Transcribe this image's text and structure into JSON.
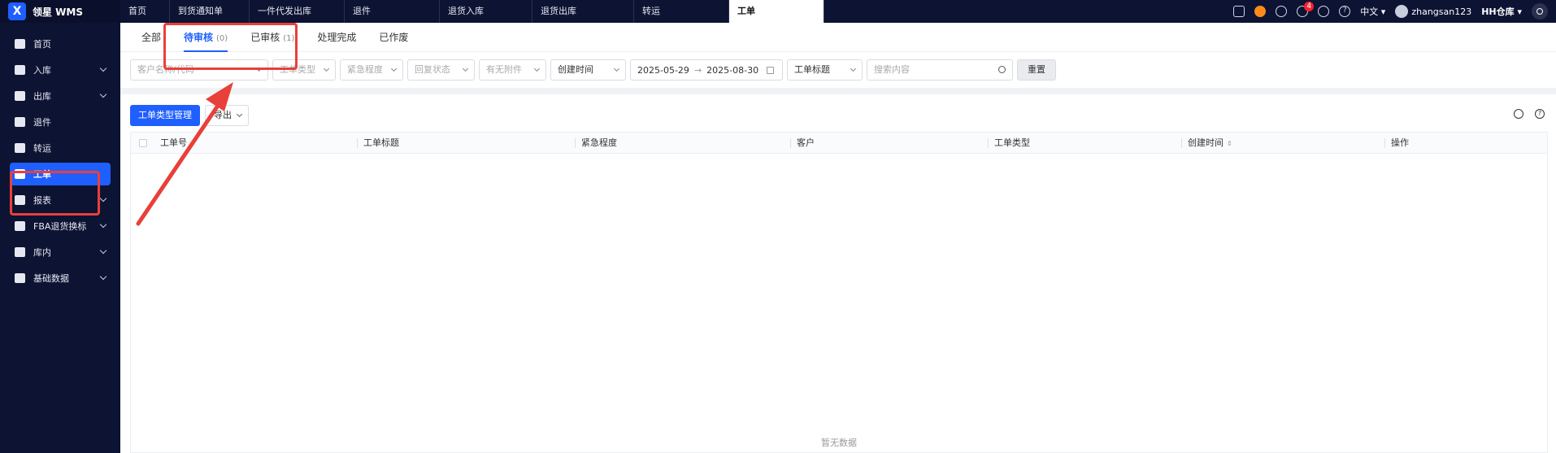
{
  "app": {
    "name": "领星 WMS",
    "logo_letter": "X"
  },
  "nav_tabs": [
    {
      "label": "首页"
    },
    {
      "label": "到货通知单"
    },
    {
      "label": "一件代发出库"
    },
    {
      "label": "退件"
    },
    {
      "label": "退货入库"
    },
    {
      "label": "退货出库"
    },
    {
      "label": "转运"
    },
    {
      "label": "工单"
    }
  ],
  "header": {
    "notification_count": "4",
    "language": "中文",
    "username": "zhangsan123",
    "warehouse": "HH仓库"
  },
  "sidebar": {
    "items": [
      {
        "label": "首页",
        "icon": "home-icon"
      },
      {
        "label": "入库",
        "icon": "inbound-icon"
      },
      {
        "label": "出库",
        "icon": "outbound-icon"
      },
      {
        "label": "退件",
        "icon": "return-icon"
      },
      {
        "label": "转运",
        "icon": "transfer-icon"
      },
      {
        "label": "工单",
        "icon": "workorder-icon"
      },
      {
        "label": "报表",
        "icon": "report-icon"
      },
      {
        "label": "FBA退货换标",
        "icon": "fba-icon"
      },
      {
        "label": "库内",
        "icon": "warehouse-icon"
      },
      {
        "label": "基础数据",
        "icon": "data-icon"
      }
    ]
  },
  "status_tabs": [
    {
      "label": "全部",
      "count": ""
    },
    {
      "label": "待审核",
      "count": "(0)"
    },
    {
      "label": "已审核",
      "count": "(1)"
    },
    {
      "label": "处理完成",
      "count": ""
    },
    {
      "label": "已作废",
      "count": ""
    }
  ],
  "filters": {
    "customer_placeholder": "客户名称/代码",
    "type_placeholder": "工单类型",
    "urgency_placeholder": "紧急程度",
    "reply_placeholder": "回复状态",
    "attachment_placeholder": "有无附件",
    "time_field": "创建时间",
    "date_start": "2025-05-29",
    "date_arrow": "→",
    "date_end": "2025-08-30",
    "search_field": "工单标题",
    "search_placeholder": "搜索内容",
    "reset_label": "重置"
  },
  "toolbar": {
    "type_manage_label": "工单类型管理",
    "export_label": "导出"
  },
  "table": {
    "columns": [
      "工单号",
      "工单标题",
      "紧急程度",
      "客户",
      "工单类型",
      "创建时间",
      "操作"
    ],
    "sort_symbol": "⇕",
    "empty_text": "暂无数据"
  }
}
